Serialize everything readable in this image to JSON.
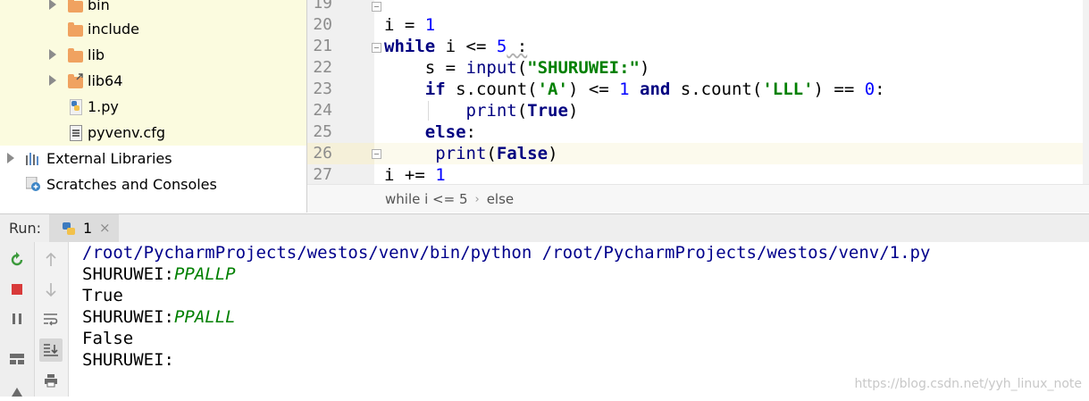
{
  "project_tree": {
    "items": [
      {
        "label": "bin",
        "icon": "folder-icon"
      },
      {
        "label": "include",
        "icon": "folder-icon"
      },
      {
        "label": "lib",
        "icon": "folder-icon"
      },
      {
        "label": "lib64",
        "icon": "folder-link-icon"
      },
      {
        "label": "1.py",
        "icon": "python-file-icon"
      },
      {
        "label": "pyvenv.cfg",
        "icon": "config-file-icon"
      },
      {
        "label": "External Libraries",
        "icon": "libraries-icon"
      },
      {
        "label": "Scratches and Consoles",
        "icon": "scratches-icon"
      }
    ]
  },
  "editor": {
    "line_numbers": [
      "19",
      "20",
      "21",
      "22",
      "23",
      "24",
      "25",
      "26",
      "27"
    ],
    "code": {
      "l20": {
        "a": "i = ",
        "b": "1"
      },
      "l21": {
        "kw": "while",
        "a": " i <= ",
        "num": "5",
        "b": " :"
      },
      "l22": {
        "a": "    s = ",
        "fn": "input",
        "p1": "(",
        "str": "\"SHURUWEI:\"",
        "p2": ")"
      },
      "l23": {
        "ind": "    ",
        "kw1": "if",
        "a": " s.count(",
        "s1": "'A'",
        "b": ") <= ",
        "n1": "1",
        "kw2": " and",
        "c": " s.count(",
        "s2": "'LLL'",
        "d": ") == ",
        "n2": "0",
        "e": ":"
      },
      "l24": {
        "ind": "        ",
        "fn": "print",
        "p1": "(",
        "kw": "True",
        "p2": ")"
      },
      "l25": {
        "ind": "    ",
        "kw": "else",
        "a": ":"
      },
      "l26": {
        "ind": "     ",
        "fn": "print",
        "p1": "(",
        "kw": "False",
        "p2": ")"
      },
      "l27": {
        "a": "i += ",
        "b": "1"
      }
    },
    "breadcrumb": [
      "while i <= 5",
      "else"
    ],
    "breadcrumb_separator": "›"
  },
  "run_panel": {
    "label": "Run:",
    "tab_name": "1",
    "tab_close": "×",
    "console": {
      "command": "/root/PycharmProjects/westos/venv/bin/python /root/PycharmProjects/westos/venv/1.py",
      "prompt1": "SHURUWEI:",
      "input1": "PPALLP",
      "out1": "True",
      "prompt2": "SHURUWEI:",
      "input2": "PPALLL",
      "out2": "False",
      "prompt3": "SHURUWEI:"
    }
  },
  "watermark": "https://blog.csdn.net/yyh_linux_note",
  "colors": {
    "keyword": "#000080",
    "number": "#0000ff",
    "string": "#008000",
    "tree_highlight": "#fbfbdf",
    "folder": "#f0a260"
  }
}
